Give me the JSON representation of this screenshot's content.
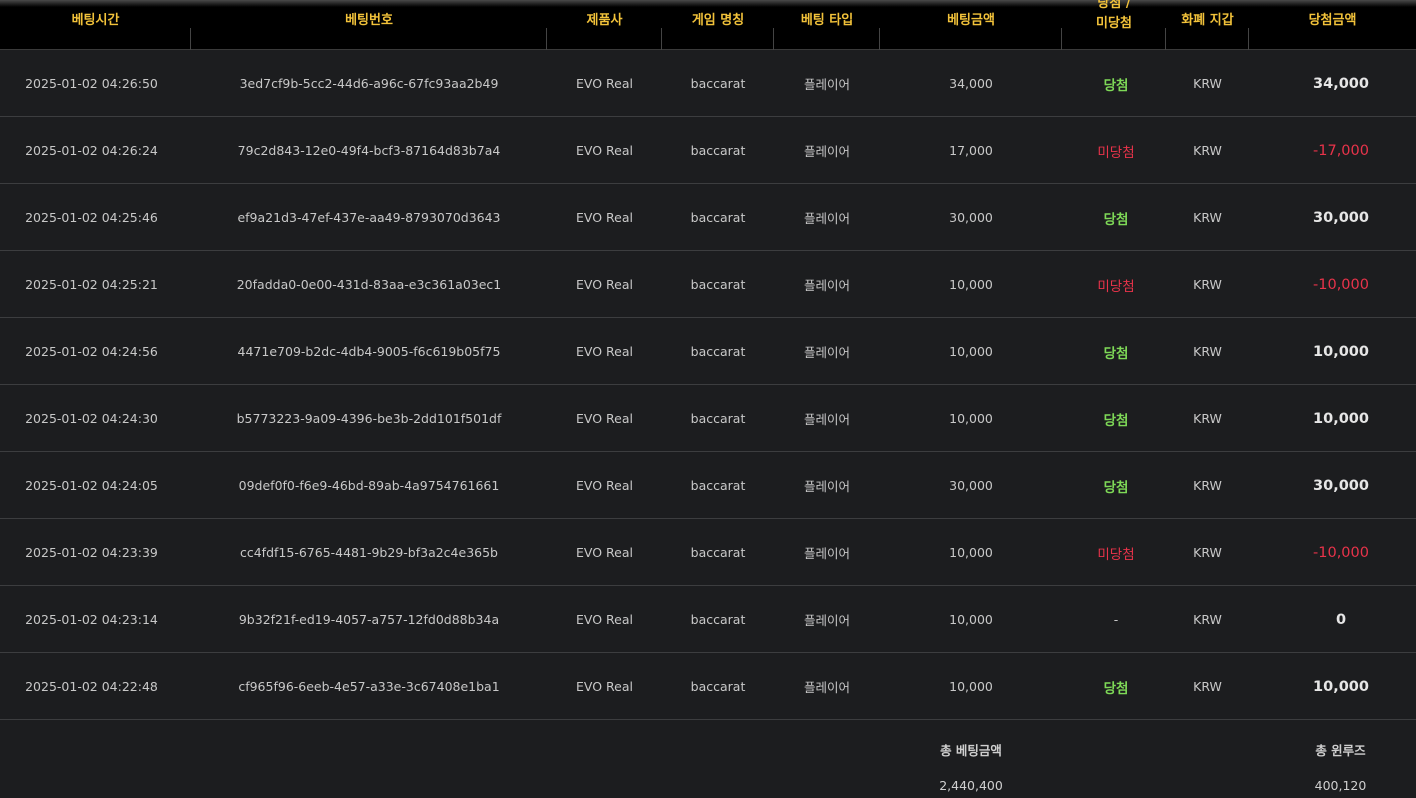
{
  "table": {
    "headers": {
      "bet_time": "베팅시간",
      "bet_number": "베팅번호",
      "provider": "제품사",
      "game_name": "게임 명칭",
      "bet_type": "베팅 타입",
      "bet_amount": "베팅금액",
      "result_line1": "당첨 /",
      "result_line2": "미당첨",
      "wallet": "화폐 지갑",
      "win_amount": "당첨금액"
    },
    "rows": [
      {
        "time": "2025-01-02 04:26:50",
        "id": "3ed7cf9b-5cc2-44d6-a96c-67fc93aa2b49",
        "provider": "EVO Real",
        "game": "baccarat",
        "type": "플레이어",
        "bet": "34,000",
        "result": "당첨",
        "status": "win",
        "wallet": "KRW",
        "payout": "34,000"
      },
      {
        "time": "2025-01-02 04:26:24",
        "id": "79c2d843-12e0-49f4-bcf3-87164d83b7a4",
        "provider": "EVO Real",
        "game": "baccarat",
        "type": "플레이어",
        "bet": "17,000",
        "result": "미당첨",
        "status": "lose",
        "wallet": "KRW",
        "payout": "-17,000"
      },
      {
        "time": "2025-01-02 04:25:46",
        "id": "ef9a21d3-47ef-437e-aa49-8793070d3643",
        "provider": "EVO Real",
        "game": "baccarat",
        "type": "플레이어",
        "bet": "30,000",
        "result": "당첨",
        "status": "win",
        "wallet": "KRW",
        "payout": "30,000"
      },
      {
        "time": "2025-01-02 04:25:21",
        "id": "20fadda0-0e00-431d-83aa-e3c361a03ec1",
        "provider": "EVO Real",
        "game": "baccarat",
        "type": "플레이어",
        "bet": "10,000",
        "result": "미당첨",
        "status": "lose",
        "wallet": "KRW",
        "payout": "-10,000"
      },
      {
        "time": "2025-01-02 04:24:56",
        "id": "4471e709-b2dc-4db4-9005-f6c619b05f75",
        "provider": "EVO Real",
        "game": "baccarat",
        "type": "플레이어",
        "bet": "10,000",
        "result": "당첨",
        "status": "win",
        "wallet": "KRW",
        "payout": "10,000"
      },
      {
        "time": "2025-01-02 04:24:30",
        "id": "b5773223-9a09-4396-be3b-2dd101f501df",
        "provider": "EVO Real",
        "game": "baccarat",
        "type": "플레이어",
        "bet": "10,000",
        "result": "당첨",
        "status": "win",
        "wallet": "KRW",
        "payout": "10,000"
      },
      {
        "time": "2025-01-02 04:24:05",
        "id": "09def0f0-f6e9-46bd-89ab-4a9754761661",
        "provider": "EVO Real",
        "game": "baccarat",
        "type": "플레이어",
        "bet": "30,000",
        "result": "당첨",
        "status": "win",
        "wallet": "KRW",
        "payout": "30,000"
      },
      {
        "time": "2025-01-02 04:23:39",
        "id": "cc4fdf15-6765-4481-9b29-bf3a2c4e365b",
        "provider": "EVO Real",
        "game": "baccarat",
        "type": "플레이어",
        "bet": "10,000",
        "result": "미당첨",
        "status": "lose",
        "wallet": "KRW",
        "payout": "-10,000"
      },
      {
        "time": "2025-01-02 04:23:14",
        "id": "9b32f21f-ed19-4057-a757-12fd0d88b34a",
        "provider": "EVO Real",
        "game": "baccarat",
        "type": "플레이어",
        "bet": "10,000",
        "result": "-",
        "status": "none",
        "wallet": "KRW",
        "payout": "0"
      },
      {
        "time": "2025-01-02 04:22:48",
        "id": "cf965f96-6eeb-4e57-a33e-3c67408e1ba1",
        "provider": "EVO Real",
        "game": "baccarat",
        "type": "플레이어",
        "bet": "10,000",
        "result": "당첨",
        "status": "win",
        "wallet": "KRW",
        "payout": "10,000"
      }
    ]
  },
  "summary": {
    "total_bet_label": "총 베팅금액",
    "total_bet_value": "2,440,400",
    "total_winloss_label": "총 윈루즈",
    "total_winloss_value": "400,120"
  },
  "colors": {
    "header_text": "#f2c23a",
    "win": "#7ed957",
    "lose": "#e8334a",
    "background": "#1c1d1f"
  }
}
